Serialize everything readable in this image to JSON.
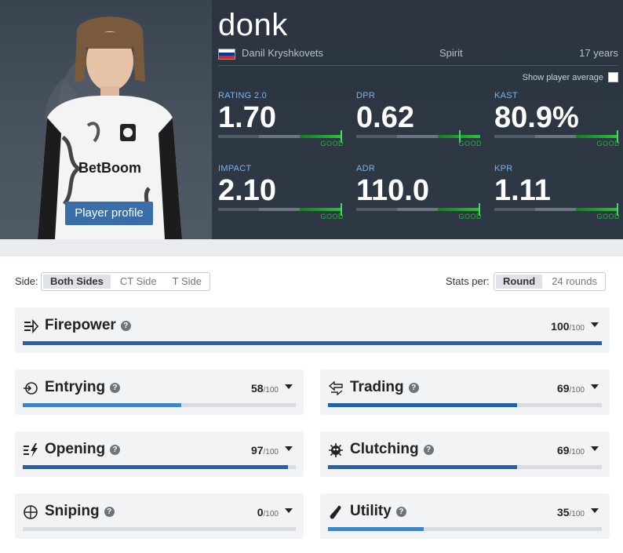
{
  "player": {
    "nickname": "donk",
    "real_name": "Danil Kryshkovets",
    "team": "Spirit",
    "age": "17 years",
    "profile_button": "Player profile",
    "show_average_label": "Show player average",
    "flag_colors": [
      "#ffffff",
      "#0039a6",
      "#d52b1e"
    ]
  },
  "stats": [
    {
      "label": "RATING 2.0",
      "value": "1.70",
      "rating": "GOOD",
      "level": 0.99
    },
    {
      "label": "DPR",
      "value": "0.62",
      "rating": "GOOD",
      "level": 0.83
    },
    {
      "label": "KAST",
      "value": "80.9%",
      "rating": "GOOD",
      "level": 1.0
    },
    {
      "label": "IMPACT",
      "value": "2.10",
      "rating": "GOOD",
      "level": 0.99
    },
    {
      "label": "ADR",
      "value": "110.0",
      "rating": "GOOD",
      "level": 0.99
    },
    {
      "label": "KPR",
      "value": "1.11",
      "rating": "GOOD",
      "level": 1.0
    }
  ],
  "filters": {
    "side_label": "Side:",
    "sides": [
      "Both Sides",
      "CT Side",
      "T Side"
    ],
    "active_side": "Both Sides",
    "stats_per_label": "Stats per:",
    "per_options": [
      "Round",
      "24 rounds"
    ],
    "active_per": "Round"
  },
  "categories": [
    {
      "name": "Firepower",
      "icon": "firepower-icon",
      "score": "100",
      "max": "/100",
      "fraction": 1.0,
      "color": "#2461a8"
    },
    {
      "name": "Entrying",
      "icon": "entrying-icon",
      "score": "58",
      "max": "/100",
      "fraction": 0.58,
      "color": "#3d85c6"
    },
    {
      "name": "Trading",
      "icon": "trading-icon",
      "score": "69",
      "max": "/100",
      "fraction": 0.69,
      "color": "#2461a8"
    },
    {
      "name": "Opening",
      "icon": "opening-icon",
      "score": "97",
      "max": "/100",
      "fraction": 0.97,
      "color": "#2461a8"
    },
    {
      "name": "Clutching",
      "icon": "clutching-icon",
      "score": "69",
      "max": "/100",
      "fraction": 0.69,
      "color": "#2461a8"
    },
    {
      "name": "Sniping",
      "icon": "sniping-icon",
      "score": "0",
      "max": "/100",
      "fraction": 0.0,
      "color": "#3d85c6"
    },
    {
      "name": "Utility",
      "icon": "utility-icon",
      "score": "35",
      "max": "/100",
      "fraction": 0.35,
      "color": "#3d85c6"
    }
  ],
  "colors": {
    "header_bg": "#2f3946",
    "accent_blue": "#3a6ea8",
    "good_green": "#27c23a",
    "stat_label": "#7db3e8"
  }
}
